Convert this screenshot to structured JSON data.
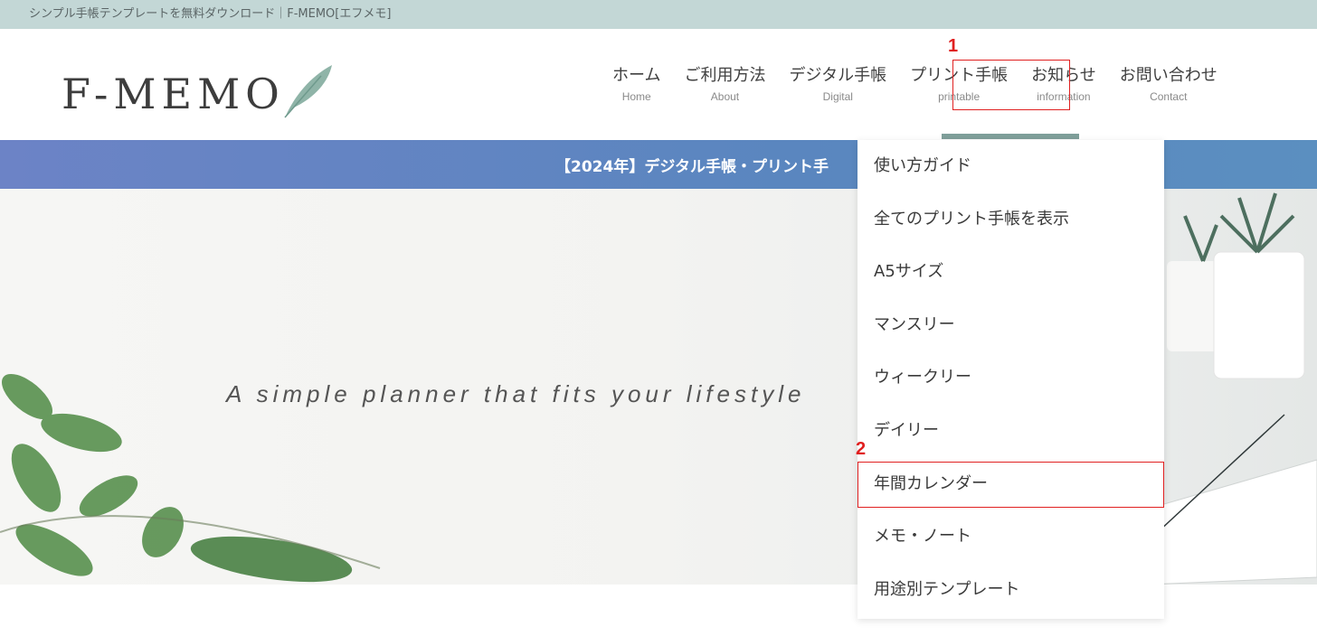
{
  "topbar": {
    "text": "シンプル手帳テンプレートを無料ダウンロード｜F-MEMO[エフメモ]"
  },
  "logo": {
    "text": "F-MEMO"
  },
  "nav": {
    "items": [
      {
        "jp": "ホーム",
        "en": "Home"
      },
      {
        "jp": "ご利用方法",
        "en": "About"
      },
      {
        "jp": "デジタル手帳",
        "en": "Digital"
      },
      {
        "jp": "プリント手帳",
        "en": "printable"
      },
      {
        "jp": "お知らせ",
        "en": "information"
      },
      {
        "jp": "お問い合わせ",
        "en": "Contact"
      }
    ]
  },
  "banner": {
    "text": "【2024年】デジタル手帳・プリント手"
  },
  "hero": {
    "tagline": "A simple planner that fits your lifestyle"
  },
  "dropdown": {
    "items": [
      "使い方ガイド",
      "全てのプリント手帳を表示",
      "A5サイズ",
      "マンスリー",
      "ウィークリー",
      "デイリー",
      "年間カレンダー",
      "メモ・ノート",
      "用途別テンプレート"
    ]
  },
  "annotations": {
    "marker1": "1",
    "marker2": "2"
  },
  "colors": {
    "topbar_bg": "#c3d7d6",
    "banner_bg": "#5a86bf",
    "highlight": "#e02020",
    "active_underline": "#7f9f9a"
  }
}
